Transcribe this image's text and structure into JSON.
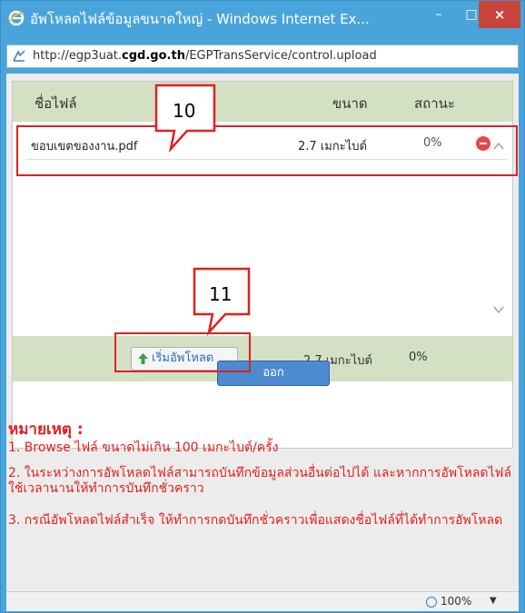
{
  "window": {
    "title": "อัพโหลดไฟล์ข้อมูลขนาดใหญ่ - Windows Internet Ex...",
    "minimize_label": "–",
    "maximize_label": "□",
    "close_label": "×"
  },
  "address": {
    "prefix": "http://egp3uat.",
    "domain": "cgd.go.th",
    "suffix": "/EGPTransService/control.upload"
  },
  "table": {
    "headers": {
      "name": "ชื่อไฟล์",
      "size": "ขนาด",
      "status": "สถานะ"
    },
    "rows": [
      {
        "name": "ขอบเขตของงาน.pdf",
        "size": "2.7 เมกะไบต์",
        "status": "0%"
      }
    ]
  },
  "footer": {
    "upload_label": "เริ่มอัพโหลด",
    "total_size": "2.7 เมกะไบต์",
    "total_status": "0%"
  },
  "exit_label": "ออก",
  "notes": {
    "title": "หมายเหตุ :",
    "items": [
      "1. Browse ไฟล์ ขนาดไม่เกิน 100 เมกะไบต์/ครั้ง",
      "2. ในระหว่างการอัพโหลดไฟล์สามารถบันทึกข้อมูลส่วนอื่นต่อไปได้ และหากการอัพโหลดไฟล์ใช้เวลานานให้ทำการบันทึกชั่วคราว",
      "3. กรณีอัพโหลดไฟล์สำเร็จ ให้ทำการกดบันทึกชั่วคราวเพื่อแสดงชื่อไฟล์ที่ได้ทำการอัพโหลด"
    ]
  },
  "status_bar": {
    "zoom": "100%"
  },
  "callouts": [
    {
      "label": "10"
    },
    {
      "label": "11"
    }
  ],
  "colors": {
    "titlebar": "#4aa4dc",
    "close_button": "#c7453a",
    "table_header": "#d4e0c4",
    "note_text": "#e02020",
    "exit_button": "#4d8ad0"
  },
  "icons": {
    "browser": "ie-logo-icon",
    "site": "site-favicon-icon",
    "remove": "remove-minus-icon",
    "upload": "upload-arrow-icon",
    "zoom": "zoom-magnifier-icon"
  }
}
